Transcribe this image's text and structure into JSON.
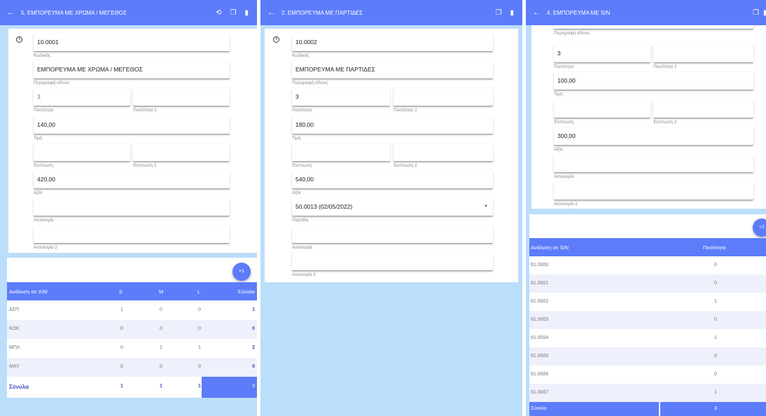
{
  "panel1": {
    "title": "5. ΕΜΠΟΡΕΥΜΑ ΜΕ ΧΡΩΜΑ / ΜΕΓΕΘΟΣ",
    "code": "10.0001",
    "code_label": "Κωδικός",
    "description": "ΕΜΠΟΡΕΥΜΑ ΜΕ ΧΡΩΜΑ / ΜΕΓΕΘΟΣ",
    "description_label": "Περιγραφή είδους",
    "quantity": "3",
    "quantity_label": "Ποσότητα",
    "quantity2_label": "Ποσότητα 2",
    "price": "140,00",
    "price_label": "Τιμή",
    "discount_label": "Έκπτωση",
    "discount2_label": "Έκπτωση 2",
    "value": "420,00",
    "value_label": "Αξία",
    "reason_label": "Αιτιολογία",
    "reason2_label": "Αιτιολογία 2",
    "fab_label": "+1",
    "table": {
      "headers": [
        "Ανάλυση σε Χ/Μ",
        "S",
        "M",
        "L",
        "Σύνολα"
      ],
      "rows": [
        {
          "name": "ΑΣΠ",
          "s": "1",
          "m": "0",
          "l": "0",
          "total": "1"
        },
        {
          "name": "ΚΟΚ",
          "s": "0",
          "m": "0",
          "l": "0",
          "total": "0"
        },
        {
          "name": "ΜΠΛ",
          "s": "0",
          "m": "1",
          "l": "1",
          "total": "2"
        },
        {
          "name": "ΜΑΥ",
          "s": "0",
          "m": "0",
          "l": "0",
          "total": "0"
        }
      ],
      "totals": {
        "name": "Σύνολα",
        "s": "1",
        "m": "1",
        "l": "1",
        "total": "3"
      }
    }
  },
  "panel2": {
    "title": "2. ΕΜΠΟΡΕΥΜΑ ΜΕ ΠΑΡΤΙΔΕΣ",
    "code": "10.0002",
    "code_label": "Κωδικός",
    "description": "ΕΜΠΟΡΕΥΜΑ ΜΕ ΠΑΡΤΙΔΕΣ",
    "description_label": "Περιγραφή είδους",
    "quantity": "3",
    "quantity_label": "Ποσότητα",
    "quantity2_label": "Ποσότητα 2",
    "price": "180,00",
    "price_label": "Τιμή",
    "discount_label": "Έκπτωση",
    "discount2_label": "Έκπτωση 2",
    "value": "540,00",
    "value_label": "Αξία",
    "batch": "50.0013 (02/05/2022)",
    "batch_label": "Παρτίδα",
    "reason_label": "Αιτιολογία",
    "reason2_label": "Αιτιολογία 2"
  },
  "panel3": {
    "title": "4. ΕΜΠΟΡΕΥΜΑ ΜΕ S/N",
    "description": "ΕΜΠΟΡΕΥΜΑ ΜΕ S/N",
    "description_label": "Περιγραφή είδους",
    "quantity": "3",
    "quantity_label": "Ποσότητα",
    "quantity2_label": "Ποσότητα 2",
    "price": "100,00",
    "price_label": "Τιμή",
    "discount_label": "Έκπτωση",
    "discount2_label": "Έκπτωση 2",
    "value": "300,00",
    "value_label": "Αξία",
    "reason_label": "Αιτιολογία",
    "reason2_label": "Αιτιολογία 2",
    "fab_label": "+1",
    "table": {
      "headers": [
        "Ανάλυση σε S/N",
        "Ποσότητα"
      ],
      "rows": [
        {
          "sn": "61.0000",
          "qty": "0"
        },
        {
          "sn": "61.0001",
          "qty": "0"
        },
        {
          "sn": "61.0002",
          "qty": "1"
        },
        {
          "sn": "61.0003",
          "qty": "0"
        },
        {
          "sn": "61.0004",
          "qty": "1"
        },
        {
          "sn": "61.0005",
          "qty": "0"
        },
        {
          "sn": "61.0006",
          "qty": "0"
        },
        {
          "sn": "61.0007",
          "qty": "1"
        }
      ],
      "totals": {
        "name": "Σύνολο",
        "qty": "3"
      }
    }
  },
  "icons": {
    "back": "arrow-left-icon",
    "history": "history-icon",
    "copy": "copy-icon",
    "delete": "delete-icon",
    "info": "info-icon",
    "dropdown": "chevron-down-icon"
  },
  "colors": {
    "appbar": "#5c7cfa",
    "background": "#bbdefb",
    "row_alt": "#eef0fc",
    "total_text": "#3f51b5"
  }
}
